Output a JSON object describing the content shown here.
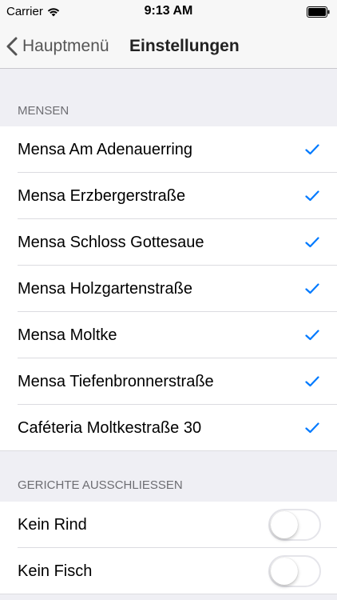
{
  "status_bar": {
    "carrier": "Carrier",
    "time": "9:13 AM"
  },
  "nav": {
    "back_label": "Hauptmenü",
    "title": "Einstellungen"
  },
  "mensen": {
    "header": "MENSEN",
    "items": [
      {
        "label": "Mensa Am Adenauerring",
        "checked": true
      },
      {
        "label": "Mensa Erzbergerstraße",
        "checked": true
      },
      {
        "label": "Mensa Schloss Gottesaue",
        "checked": true
      },
      {
        "label": "Mensa Holzgartenstraße",
        "checked": true
      },
      {
        "label": "Mensa Moltke",
        "checked": true
      },
      {
        "label": "Mensa Tiefenbronnerstraße",
        "checked": true
      },
      {
        "label": "Caféteria Moltkestraße 30",
        "checked": true
      }
    ]
  },
  "gerichte": {
    "header": "GERICHTE AUSSCHLIESSEN",
    "items": [
      {
        "label": "Kein Rind",
        "enabled": false
      },
      {
        "label": "Kein Fisch",
        "enabled": false
      }
    ]
  },
  "colors": {
    "accent": "#007aff",
    "background": "#efeff4",
    "toggle_border": "#e5e5ea"
  }
}
